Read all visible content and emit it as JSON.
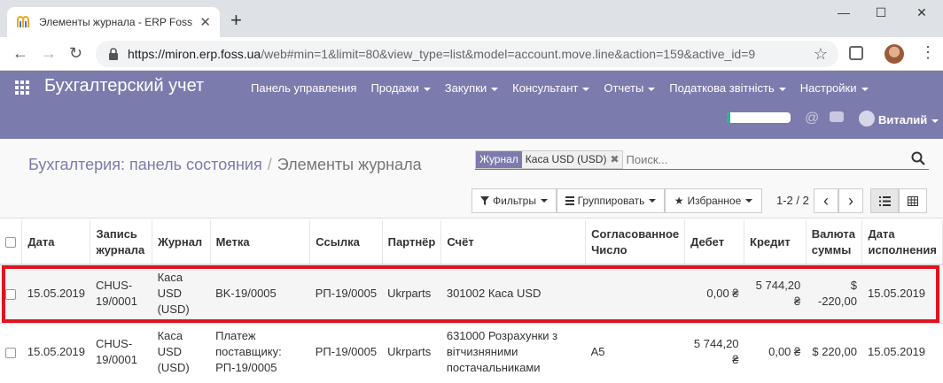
{
  "browser": {
    "tab_title": "Элементы журнала - ERP Foss",
    "tab_close": "✕",
    "new_tab": "+",
    "url_host": "https://miron.erp.foss.ua",
    "url_path": "/web#min=1&limit=80&view_type=list&model=account.move.line&action=159&active_id=9",
    "back": "←",
    "forward": "→",
    "reload": "↻",
    "star": "☆",
    "menu": "⋮",
    "minimize": "—",
    "maximize": "☐",
    "close": "✕"
  },
  "app": {
    "brand": "Бухгалтерский учет",
    "menu": [
      {
        "label": "Панель управления",
        "dropdown": false
      },
      {
        "label": "Продажи",
        "dropdown": true
      },
      {
        "label": "Закупки",
        "dropdown": true
      },
      {
        "label": "Консультант",
        "dropdown": true
      },
      {
        "label": "Отчеты",
        "dropdown": true
      },
      {
        "label": "Податкова звітність",
        "dropdown": true
      },
      {
        "label": "Настройки",
        "dropdown": true
      }
    ],
    "progress": 0.05,
    "at_symbol": "@",
    "user_name": "Виталий",
    "nav_color": "#7c7bad"
  },
  "control_panel": {
    "breadcrumb_link": "Бухгалтерия: панель состояния",
    "breadcrumb_sep": "/",
    "breadcrumb_current": "Элементы журнала",
    "facet_name": "Журнал",
    "facet_value": "Каса USD (USD)",
    "facet_remove": "✖",
    "search_placeholder": "Поиск...",
    "filters": "Фильтры",
    "group_by": "Группировать",
    "favorites": "Избранное",
    "pager": "1-2 / 2",
    "prev": "‹",
    "next": "›"
  },
  "table": {
    "columns": [
      "Дата",
      "Запись журнала",
      "Журнал",
      "Метка",
      "Ссылка",
      "Партнёр",
      "Счёт",
      "Согласованное Число",
      "Дебет",
      "Кредит",
      "Валюта суммы",
      "Дата исполнения"
    ],
    "rows": [
      {
        "date": "15.05.2019",
        "move": "CHUS-19/0001",
        "journal": "Каса USD (USD)",
        "label": "BK-19/0005",
        "ref": "РП-19/0005",
        "partner": "Ukrparts",
        "account": "301002 Каса USD",
        "matching": "",
        "debit": "0,00 ₴",
        "credit": "5 744,20 ₴",
        "amount_currency": "$ -220,00",
        "due_date": "15.05.2019"
      },
      {
        "date": "15.05.2019",
        "move": "CHUS-19/0001",
        "journal": "Каса USD (USD)",
        "label": "Платеж поставщику: РП-19/0005",
        "ref": "РП-19/0005",
        "partner": "Ukrparts",
        "account": "631000 Розрахунки з вітчизняними постачальниками",
        "matching": "A5",
        "debit": "5 744,20 ₴",
        "credit": "0,00 ₴",
        "amount_currency": "$ 220,00",
        "due_date": "15.05.2019"
      }
    ]
  },
  "highlight_color": "#e0141f"
}
